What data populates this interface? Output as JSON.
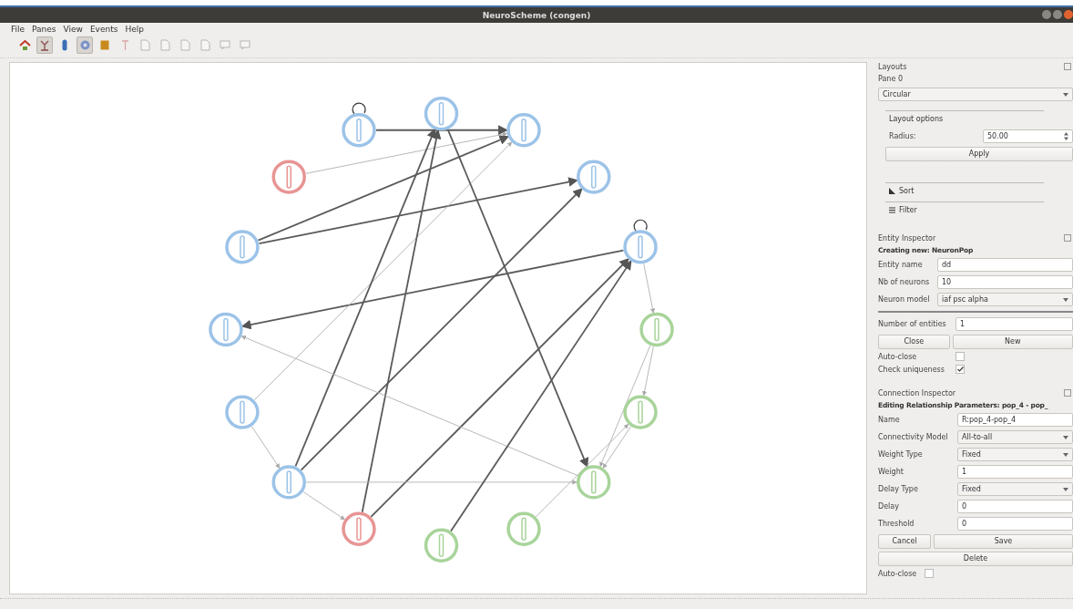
{
  "window": {
    "title": "NeuroScheme (congen)"
  },
  "menu": [
    "File",
    "Panes",
    "View",
    "Events",
    "Help"
  ],
  "toolbar": [
    {
      "kind": "home",
      "selected": false,
      "disabled": false
    },
    {
      "kind": "branch",
      "selected": true,
      "disabled": false
    },
    {
      "kind": "capsule",
      "selected": false,
      "disabled": false
    },
    {
      "kind": "gear",
      "selected": true,
      "disabled": false
    },
    {
      "kind": "square",
      "selected": false,
      "disabled": false
    },
    {
      "kind": "pin",
      "selected": false,
      "disabled": true
    },
    {
      "kind": "page",
      "selected": false,
      "disabled": true
    },
    {
      "kind": "page",
      "selected": false,
      "disabled": true
    },
    {
      "kind": "page",
      "selected": false,
      "disabled": true
    },
    {
      "kind": "page",
      "selected": false,
      "disabled": true
    },
    {
      "kind": "bubble",
      "selected": false,
      "disabled": true
    },
    {
      "kind": "bubble",
      "selected": false,
      "disabled": true
    }
  ],
  "graph": {
    "nodes": [
      {
        "color": "#9cc3e8",
        "self_loop": false
      },
      {
        "color": "#9cc3e8",
        "self_loop": false
      },
      {
        "color": "#9cc3e8",
        "self_loop": false
      },
      {
        "color": "#9cc3e8",
        "self_loop": true
      },
      {
        "color": "#a8d49a",
        "self_loop": false
      },
      {
        "color": "#a8d49a",
        "self_loop": false
      },
      {
        "color": "#a8d49a",
        "self_loop": false
      },
      {
        "color": "#a8d49a",
        "self_loop": false
      },
      {
        "color": "#a8d49a",
        "self_loop": false
      },
      {
        "color": "#e89494",
        "self_loop": false
      },
      {
        "color": "#9cc3e8",
        "self_loop": false
      },
      {
        "color": "#9cc3e8",
        "self_loop": false
      },
      {
        "color": "#9cc3e8",
        "self_loop": false
      },
      {
        "color": "#9cc3e8",
        "self_loop": false
      },
      {
        "color": "#e89494",
        "self_loop": false
      },
      {
        "color": "#9cc3e8",
        "self_loop": true
      }
    ]
  },
  "layouts": {
    "title": "Layouts",
    "pane": "Pane 0",
    "layout": "Circular",
    "options_tab": "Layout options",
    "radius_label": "Radius:",
    "radius": "50.00",
    "apply": "Apply",
    "sections": [
      "Sort",
      "Filter"
    ]
  },
  "entity_inspector": {
    "title": "Entity Inspector",
    "heading": "Creating new: NeuronPop",
    "fields": [
      {
        "label": "Entity name",
        "value": "dd",
        "kind": "text"
      },
      {
        "label": "Nb of neurons",
        "value": "10",
        "kind": "text"
      },
      {
        "label": "Neuron model",
        "value": "iaf psc alpha",
        "kind": "select"
      }
    ],
    "count_label": "Number of entities",
    "count": "1",
    "buttons": [
      "Close",
      "New"
    ],
    "checks": [
      {
        "label": "Auto-close",
        "checked": false
      },
      {
        "label": "Check uniqueness",
        "checked": true
      }
    ]
  },
  "connection_inspector": {
    "title": "Connection Inspector",
    "heading": "Editing Relationship Parameters: pop_4 - pop_",
    "fields": [
      {
        "label": "Name",
        "value": "R:pop_4-pop_4",
        "kind": "text"
      },
      {
        "label": "Connectivity Model",
        "value": "All-to-all",
        "kind": "select"
      },
      {
        "label": "Weight Type",
        "value": "Fixed",
        "kind": "select"
      },
      {
        "label": "Weight",
        "value": "1",
        "kind": "text"
      },
      {
        "label": "Delay Type",
        "value": "Fixed",
        "kind": "select"
      },
      {
        "label": "Delay",
        "value": "0",
        "kind": "text"
      },
      {
        "label": "Threshold",
        "value": "0",
        "kind": "text"
      }
    ],
    "buttons": [
      "Cancel",
      "Save"
    ],
    "delete": "Delete",
    "checks": [
      {
        "label": "Auto-close",
        "checked": false
      }
    ]
  }
}
